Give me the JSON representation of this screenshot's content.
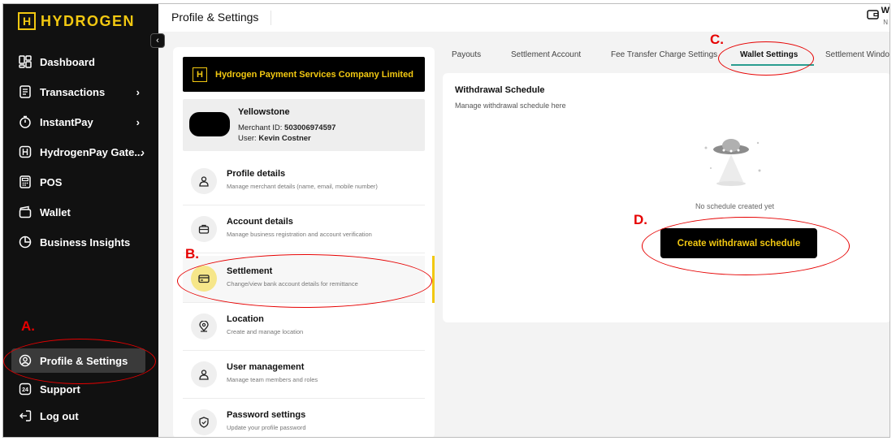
{
  "brand": {
    "logo_letter": "H",
    "name": "HYDROGEN"
  },
  "sidebar": {
    "items": [
      {
        "label": "Dashboard",
        "icon": "dashboard-icon"
      },
      {
        "label": "Transactions",
        "icon": "receipt-icon",
        "chevron": "›"
      },
      {
        "label": "InstantPay",
        "icon": "stopwatch-icon",
        "chevron": "›"
      },
      {
        "label": "HydrogenPay Gate...",
        "icon": "gateway-icon",
        "chevron": "›"
      },
      {
        "label": "POS",
        "icon": "pos-icon"
      },
      {
        "label": "Wallet",
        "icon": "wallet-icon"
      },
      {
        "label": "Business Insights",
        "icon": "pie-chart-icon"
      }
    ],
    "bottom_items": [
      {
        "label": "Profile & Settings",
        "icon": "user-circle-icon",
        "active": true
      },
      {
        "label": "Support",
        "icon": "support-24-icon"
      },
      {
        "label": "Log out",
        "icon": "logout-icon"
      }
    ]
  },
  "header": {
    "title": "Profile & Settings",
    "initial": "W",
    "sub_initial": "N"
  },
  "company": {
    "name": "Hydrogen Payment Services Company Limited",
    "logo_letter": "H"
  },
  "merchant": {
    "name": "Yellowstone",
    "id_label": "Merchant ID: ",
    "id_value": "503006974597",
    "user_label": "User: ",
    "user_value": "Kevin Costner"
  },
  "settings_menu": [
    {
      "title": "Profile details",
      "subtitle": "Manage merchant details (name, email, mobile number)",
      "icon": "user-icon"
    },
    {
      "title": "Account details",
      "subtitle": "Manage business registration and account verification",
      "icon": "briefcase-icon"
    },
    {
      "title": "Settlement",
      "subtitle": "Change/view bank account details for remittance",
      "icon": "card-icon",
      "active": true
    },
    {
      "title": "Location",
      "subtitle": "Create and manage location",
      "icon": "location-pin-icon"
    },
    {
      "title": "User management",
      "subtitle": "Manage team members and roles",
      "icon": "users-icon"
    },
    {
      "title": "Password settings",
      "subtitle": "Update your profile password",
      "icon": "shield-icon"
    }
  ],
  "tabs": [
    {
      "label": "Payouts"
    },
    {
      "label": "Settlement Account"
    },
    {
      "label": "Fee Transfer Charge Settings"
    },
    {
      "label": "Wallet Settings",
      "active": true
    },
    {
      "label": "Settlement Window"
    }
  ],
  "wallet_settings": {
    "title": "Withdrawal Schedule",
    "subtitle": "Manage withdrawal schedule here",
    "empty_text": "No schedule created yet",
    "create_button": "Create withdrawal schedule"
  },
  "annotations": {
    "a": "A.",
    "b": "B.",
    "c": "C.",
    "d": "D."
  },
  "colors": {
    "brand_yellow": "#f2c811",
    "sidebar_bg": "#111111",
    "annotation_red": "#e60000",
    "tab_underline": "#2a9d8f"
  }
}
